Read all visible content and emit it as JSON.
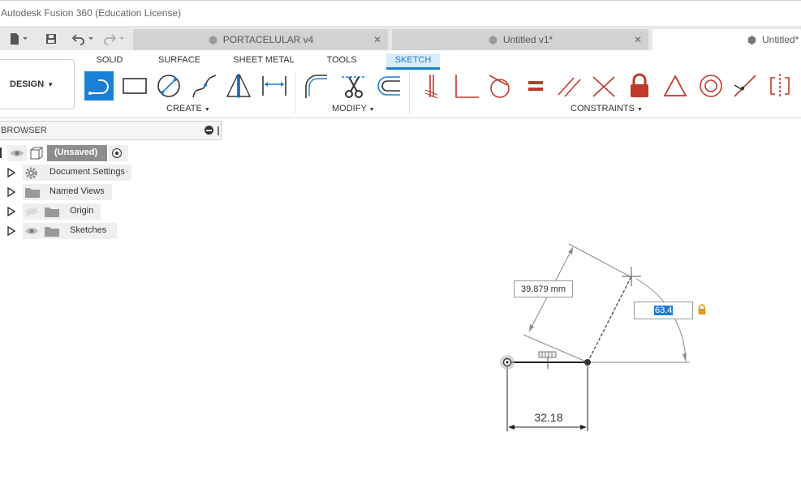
{
  "window": {
    "title": "Autodesk Fusion 360 (Education License)"
  },
  "tabs": [
    {
      "label": "PORTACELULAR v4",
      "active": false
    },
    {
      "label": "Untitled v1*",
      "active": false
    },
    {
      "label": "Untitled*",
      "active": true
    }
  ],
  "toolbar": {
    "workspace": "DESIGN",
    "workspace_tabs": [
      "SOLID",
      "SURFACE",
      "SHEET METAL",
      "TOOLS",
      "SKETCH"
    ],
    "active_tab": "SKETCH",
    "groups": {
      "create": "CREATE",
      "modify": "MODIFY",
      "constraints": "CONSTRAINTS"
    }
  },
  "browser": {
    "title": "BROWSER",
    "items": [
      {
        "label": "(Unsaved)"
      },
      {
        "label": "Document Settings"
      },
      {
        "label": "Named Views"
      },
      {
        "label": "Origin"
      },
      {
        "label": "Sketches"
      }
    ]
  },
  "sketch": {
    "aligned_dimension": "39.879 mm",
    "angle_value": "63.4",
    "horizontal_dimension": "32.18"
  },
  "colors": {
    "accent": "#1a7fd6",
    "constraint_red": "#c0392b",
    "lock": "#d4a017"
  }
}
